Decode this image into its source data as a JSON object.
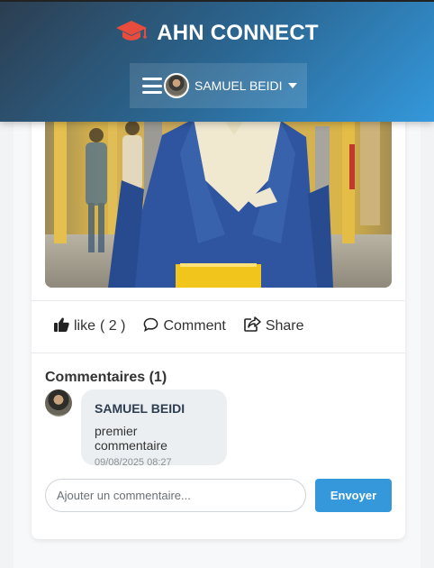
{
  "header": {
    "brand": "AHN CONNECT",
    "brand_icon": "graduation-cap-icon",
    "user_name": "SAMUEL BEIDI",
    "menu_icon": "hamburger-icon",
    "dropdown_icon": "caret-down-icon"
  },
  "post": {
    "actions": {
      "like_label": "like",
      "like_count": "( 2 )",
      "comment_label": "Comment",
      "share_label": "Share"
    }
  },
  "comments": {
    "title": "Commentaires (1)",
    "items": [
      {
        "author": "SAMUEL BEIDI",
        "text": "premier commentaire",
        "date": "09/08/2025 08:27"
      }
    ],
    "input_placeholder": "Ajouter un commentaire...",
    "send_label": "Envoyer"
  },
  "colors": {
    "accent": "#3498db",
    "header_dark": "#2c3e50",
    "brand_icon": "#e74c3c"
  }
}
